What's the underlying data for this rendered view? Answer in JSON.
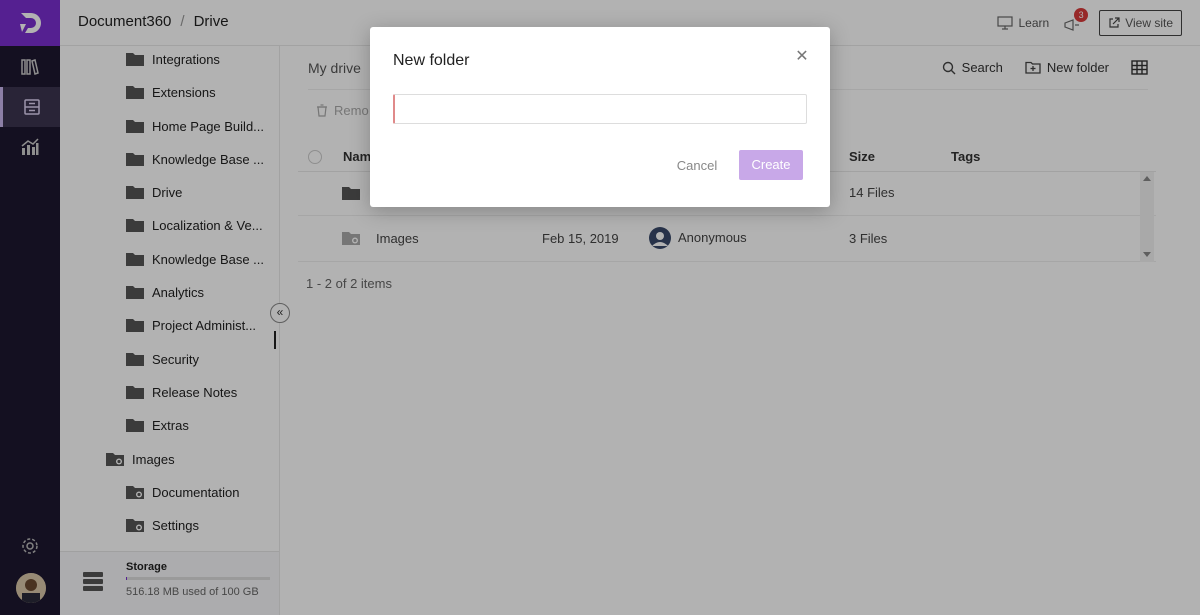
{
  "header": {
    "breadcrumb": [
      "Document360",
      "Drive"
    ],
    "learn_label": "Learn",
    "notification_count": "3",
    "view_site_label": "View site"
  },
  "tree": {
    "items": [
      {
        "label": "Integrations"
      },
      {
        "label": "Extensions"
      },
      {
        "label": "Home Page Build..."
      },
      {
        "label": "Knowledge Base ..."
      },
      {
        "label": "Drive"
      },
      {
        "label": "Localization & Ve..."
      },
      {
        "label": "Knowledge Base ..."
      },
      {
        "label": "Analytics"
      },
      {
        "label": "Project Administ..."
      },
      {
        "label": "Security"
      },
      {
        "label": "Release Notes"
      },
      {
        "label": "Extras"
      }
    ],
    "images_label": "Images",
    "sub_items": [
      {
        "label": "Documentation"
      },
      {
        "label": "Settings"
      }
    ],
    "storage": {
      "title": "Storage",
      "used_text": "516.18 MB used of 100 GB",
      "used_fraction": 0.005
    }
  },
  "main": {
    "my_drive_label": "My drive",
    "search_label": "Search",
    "new_folder_label": "New folder",
    "remove_label": "Remo",
    "columns": [
      "Nam",
      "Size",
      "Tags"
    ],
    "rows": [
      {
        "name": "",
        "date": "",
        "owner": "",
        "size": "14 Files"
      },
      {
        "name": "Images",
        "date": "Feb 15, 2019",
        "owner": "Anonymous",
        "size": "3 Files"
      }
    ],
    "pager_text": "1 - 2 of 2 items"
  },
  "modal": {
    "title": "New folder",
    "input_value": "",
    "input_placeholder": "",
    "cancel_label": "Cancel",
    "create_label": "Create"
  },
  "colors": {
    "brand": "#7a2fd0",
    "rail_bg": "#1e1830",
    "create_button": "#c8a8e8",
    "badge": "#d93a3a"
  }
}
